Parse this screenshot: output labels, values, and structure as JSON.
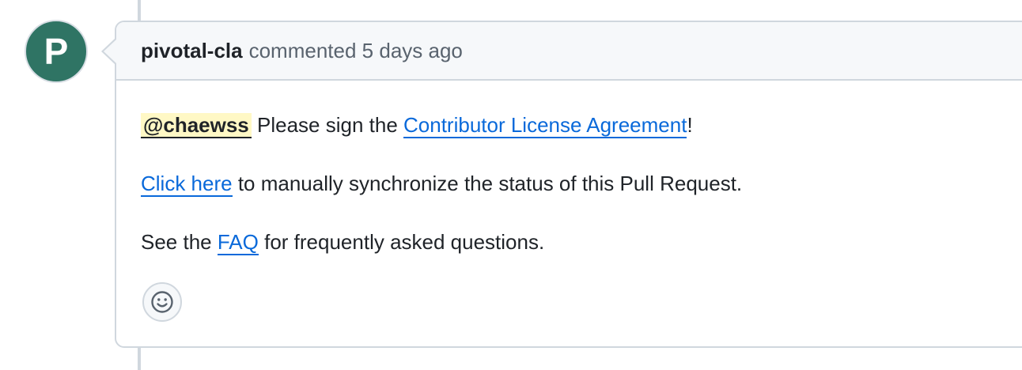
{
  "avatar": {
    "initial": "P",
    "color": "#2f7464"
  },
  "comment": {
    "author": "pivotal-cla",
    "action": "commented",
    "time": "5 days ago",
    "mention": "@chaewss",
    "line1_text_a": " Please sign the ",
    "line1_link": "Contributor License Agreement",
    "line1_text_b": "!",
    "line2_link": "Click here",
    "line2_text": " to manually synchronize the status of this Pull Request.",
    "line3_text_a": "See the ",
    "line3_link": "FAQ",
    "line3_text_b": " for frequently asked questions."
  },
  "reaction": {
    "icon": "smiley-icon"
  },
  "colors": {
    "link": "#0969da",
    "mention_bg": "#fff8c5",
    "header_bg": "#f6f8fa",
    "border": "#d0d7de"
  }
}
